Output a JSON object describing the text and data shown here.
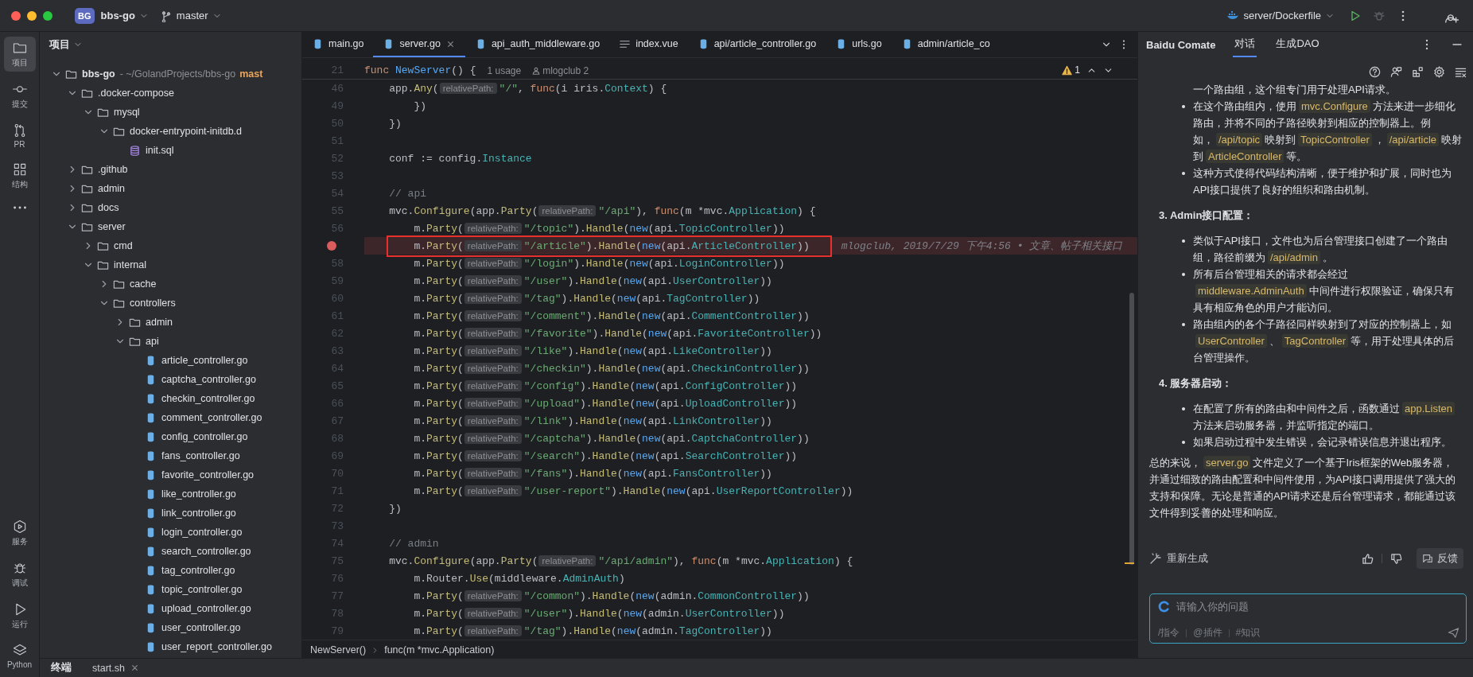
{
  "titlebar": {
    "project_badge": "BG",
    "project": "bbs-go",
    "branch": "master",
    "run_config": "server/Dockerfile"
  },
  "rail": {
    "top": [
      {
        "label": "项目",
        "selected": true
      },
      {
        "label": "提交",
        "selected": false
      },
      {
        "label": "PR",
        "selected": false
      },
      {
        "label": "结构",
        "selected": false
      }
    ],
    "bottom": [
      {
        "label": "服务",
        "selected": false
      },
      {
        "label": "调试",
        "selected": false
      },
      {
        "label": "运行",
        "selected": false
      },
      {
        "label": "Python",
        "selected": false
      }
    ]
  },
  "project": {
    "title": "项目",
    "root": {
      "name": "bbs-go",
      "path": "- ~/GolandProjects/bbs-go",
      "branch": "mast",
      "kind": "folder",
      "expanded": true,
      "children": [
        {
          "name": ".docker-compose",
          "kind": "folder",
          "expanded": true,
          "children": [
            {
              "name": "mysql",
              "kind": "folder",
              "expanded": true,
              "children": [
                {
                  "name": "docker-entrypoint-initdb.d",
                  "kind": "folder",
                  "expanded": true,
                  "children": [
                    {
                      "name": "init.sql",
                      "kind": "sql"
                    }
                  ]
                }
              ]
            }
          ]
        },
        {
          "name": ".github",
          "kind": "folder",
          "expanded": false
        },
        {
          "name": "admin",
          "kind": "folder",
          "expanded": false
        },
        {
          "name": "docs",
          "kind": "folder",
          "expanded": false
        },
        {
          "name": "server",
          "kind": "folder",
          "expanded": true,
          "children": [
            {
              "name": "cmd",
              "kind": "folder",
              "expanded": false
            },
            {
              "name": "internal",
              "kind": "folder",
              "expanded": true,
              "children": [
                {
                  "name": "cache",
                  "kind": "folder",
                  "expanded": false
                },
                {
                  "name": "controllers",
                  "kind": "folder",
                  "expanded": true,
                  "children": [
                    {
                      "name": "admin",
                      "kind": "folder",
                      "expanded": false
                    },
                    {
                      "name": "api",
                      "kind": "folder",
                      "expanded": true,
                      "children": [
                        {
                          "name": "article_controller.go",
                          "kind": "go"
                        },
                        {
                          "name": "captcha_controller.go",
                          "kind": "go"
                        },
                        {
                          "name": "checkin_controller.go",
                          "kind": "go"
                        },
                        {
                          "name": "comment_controller.go",
                          "kind": "go"
                        },
                        {
                          "name": "config_controller.go",
                          "kind": "go"
                        },
                        {
                          "name": "fans_controller.go",
                          "kind": "go"
                        },
                        {
                          "name": "favorite_controller.go",
                          "kind": "go"
                        },
                        {
                          "name": "like_controller.go",
                          "kind": "go"
                        },
                        {
                          "name": "link_controller.go",
                          "kind": "go"
                        },
                        {
                          "name": "login_controller.go",
                          "kind": "go"
                        },
                        {
                          "name": "search_controller.go",
                          "kind": "go"
                        },
                        {
                          "name": "tag_controller.go",
                          "kind": "go"
                        },
                        {
                          "name": "topic_controller.go",
                          "kind": "go"
                        },
                        {
                          "name": "upload_controller.go",
                          "kind": "go"
                        },
                        {
                          "name": "user_controller.go",
                          "kind": "go"
                        },
                        {
                          "name": "user_report_controller.go",
                          "kind": "go"
                        }
                      ]
                    }
                  ]
                }
              ]
            }
          ]
        }
      ]
    }
  },
  "editor": {
    "tabs": [
      {
        "label": "main.go",
        "kind": "go",
        "selected": false
      },
      {
        "label": "server.go",
        "kind": "go",
        "selected": true
      },
      {
        "label": "api_auth_middleware.go",
        "kind": "go",
        "selected": false
      },
      {
        "label": "index.vue",
        "kind": "vue",
        "selected": false
      },
      {
        "label": "api/article_controller.go",
        "kind": "go",
        "selected": false
      },
      {
        "label": "urls.go",
        "kind": "go",
        "selected": false
      },
      {
        "label": "admin/article_co",
        "kind": "go",
        "selected": false
      }
    ],
    "sticky_line": {
      "number": "21",
      "tokens": [
        {
          "kind": "keyword",
          "text": "func "
        },
        {
          "kind": "decl",
          "text": "NewServer"
        },
        {
          "kind": "plain",
          "text": "() {"
        }
      ],
      "hints": [
        {
          "kind": "usage",
          "text": "1 usage"
        },
        {
          "kind": "author",
          "text": "mlogclub 2"
        }
      ]
    },
    "warnings": "1",
    "lines": [
      {
        "number": "46",
        "breakpoint": false,
        "framed": false,
        "tokens": [
          {
            "kind": "plain",
            "text": "    app."
          },
          {
            "kind": "call",
            "text": "Any"
          },
          {
            "kind": "plain",
            "text": "("
          },
          {
            "kind": "hint",
            "text": "relativePath:"
          },
          {
            "kind": "string",
            "text": "\"/\""
          },
          {
            "kind": "plain",
            "text": ", "
          },
          {
            "kind": "keyword",
            "text": "func"
          },
          {
            "kind": "plain",
            "text": "(i iris."
          },
          {
            "kind": "type",
            "text": "Context"
          },
          {
            "kind": "plain",
            "text": ") {"
          }
        ]
      },
      {
        "number": "49",
        "breakpoint": false,
        "framed": false,
        "tokens": [
          {
            "kind": "plain",
            "text": "        })"
          }
        ]
      },
      {
        "number": "50",
        "breakpoint": false,
        "framed": false,
        "tokens": [
          {
            "kind": "plain",
            "text": "    })"
          }
        ]
      },
      {
        "number": "51",
        "breakpoint": false,
        "framed": false
      },
      {
        "number": "52",
        "breakpoint": false,
        "framed": false,
        "tokens": [
          {
            "kind": "plain",
            "text": "    conf := config."
          },
          {
            "kind": "type",
            "text": "Instance"
          }
        ]
      },
      {
        "number": "53",
        "breakpoint": false,
        "framed": false
      },
      {
        "number": "54",
        "breakpoint": false,
        "framed": false,
        "tokens": [
          {
            "kind": "comment",
            "text": "    // api"
          }
        ]
      },
      {
        "number": "55",
        "breakpoint": false,
        "framed": false,
        "tokens": [
          {
            "kind": "plain",
            "text": "    mvc."
          },
          {
            "kind": "call",
            "text": "Configure"
          },
          {
            "kind": "plain",
            "text": "(app."
          },
          {
            "kind": "call",
            "text": "Party"
          },
          {
            "kind": "plain",
            "text": "("
          },
          {
            "kind": "hint",
            "text": "relativePath:"
          },
          {
            "kind": "string",
            "text": "\"/api\""
          },
          {
            "kind": "plain",
            "text": "), "
          },
          {
            "kind": "keyword",
            "text": "func"
          },
          {
            "kind": "plain",
            "text": "(m *mvc."
          },
          {
            "kind": "type",
            "text": "Application"
          },
          {
            "kind": "plain",
            "text": ") {"
          }
        ]
      },
      {
        "number": "56",
        "breakpoint": false,
        "framed": false,
        "tokens": [
          {
            "kind": "plain",
            "text": "        m."
          },
          {
            "kind": "call",
            "text": "Party"
          },
          {
            "kind": "plain",
            "text": "("
          },
          {
            "kind": "hint",
            "text": "relativePath:"
          },
          {
            "kind": "string",
            "text": "\"/topic\""
          },
          {
            "kind": "plain",
            "text": ")."
          },
          {
            "kind": "call",
            "text": "Handle"
          },
          {
            "kind": "plain",
            "text": "("
          },
          {
            "kind": "builtin",
            "text": "new"
          },
          {
            "kind": "plain",
            "text": "(api."
          },
          {
            "kind": "type",
            "text": "TopicController"
          },
          {
            "kind": "plain",
            "text": "))"
          }
        ]
      },
      {
        "breakpoint": true,
        "framed": true,
        "blame": "mlogclub, 2019/7/29 下午4:56 • 文章、帖子相关接口",
        "tokens": [
          {
            "kind": "plain",
            "text": "        m."
          },
          {
            "kind": "call",
            "text": "Party"
          },
          {
            "kind": "plain",
            "text": "("
          },
          {
            "kind": "hint",
            "text": "relativePath:"
          },
          {
            "kind": "string",
            "text": "\"/article\""
          },
          {
            "kind": "plain",
            "text": ")."
          },
          {
            "kind": "call",
            "text": "Handle"
          },
          {
            "kind": "plain",
            "text": "("
          },
          {
            "kind": "builtin",
            "text": "new"
          },
          {
            "kind": "plain",
            "text": "(api."
          },
          {
            "kind": "type",
            "text": "ArticleController"
          },
          {
            "kind": "plain",
            "text": "))"
          }
        ]
      },
      {
        "number": "58",
        "breakpoint": false,
        "framed": false,
        "tokens": [
          {
            "kind": "plain",
            "text": "        m."
          },
          {
            "kind": "call",
            "text": "Party"
          },
          {
            "kind": "plain",
            "text": "("
          },
          {
            "kind": "hint",
            "text": "relativePath:"
          },
          {
            "kind": "string",
            "text": "\"/login\""
          },
          {
            "kind": "plain",
            "text": ")."
          },
          {
            "kind": "call",
            "text": "Handle"
          },
          {
            "kind": "plain",
            "text": "("
          },
          {
            "kind": "builtin",
            "text": "new"
          },
          {
            "kind": "plain",
            "text": "(api."
          },
          {
            "kind": "type",
            "text": "LoginController"
          },
          {
            "kind": "plain",
            "text": "))"
          }
        ]
      },
      {
        "number": "59",
        "breakpoint": false,
        "framed": false,
        "tokens": [
          {
            "kind": "plain",
            "text": "        m."
          },
          {
            "kind": "call",
            "text": "Party"
          },
          {
            "kind": "plain",
            "text": "("
          },
          {
            "kind": "hint",
            "text": "relativePath:"
          },
          {
            "kind": "string",
            "text": "\"/user\""
          },
          {
            "kind": "plain",
            "text": ")."
          },
          {
            "kind": "call",
            "text": "Handle"
          },
          {
            "kind": "plain",
            "text": "("
          },
          {
            "kind": "builtin",
            "text": "new"
          },
          {
            "kind": "plain",
            "text": "(api."
          },
          {
            "kind": "type",
            "text": "UserController"
          },
          {
            "kind": "plain",
            "text": "))"
          }
        ]
      },
      {
        "number": "60",
        "breakpoint": false,
        "framed": false,
        "tokens": [
          {
            "kind": "plain",
            "text": "        m."
          },
          {
            "kind": "call",
            "text": "Party"
          },
          {
            "kind": "plain",
            "text": "("
          },
          {
            "kind": "hint",
            "text": "relativePath:"
          },
          {
            "kind": "string",
            "text": "\"/tag\""
          },
          {
            "kind": "plain",
            "text": ")."
          },
          {
            "kind": "call",
            "text": "Handle"
          },
          {
            "kind": "plain",
            "text": "("
          },
          {
            "kind": "builtin",
            "text": "new"
          },
          {
            "kind": "plain",
            "text": "(api."
          },
          {
            "kind": "type",
            "text": "TagController"
          },
          {
            "kind": "plain",
            "text": "))"
          }
        ]
      },
      {
        "number": "61",
        "breakpoint": false,
        "framed": false,
        "tokens": [
          {
            "kind": "plain",
            "text": "        m."
          },
          {
            "kind": "call",
            "text": "Party"
          },
          {
            "kind": "plain",
            "text": "("
          },
          {
            "kind": "hint",
            "text": "relativePath:"
          },
          {
            "kind": "string",
            "text": "\"/comment\""
          },
          {
            "kind": "plain",
            "text": ")."
          },
          {
            "kind": "call",
            "text": "Handle"
          },
          {
            "kind": "plain",
            "text": "("
          },
          {
            "kind": "builtin",
            "text": "new"
          },
          {
            "kind": "plain",
            "text": "(api."
          },
          {
            "kind": "type",
            "text": "CommentController"
          },
          {
            "kind": "plain",
            "text": "))"
          }
        ]
      },
      {
        "number": "62",
        "breakpoint": false,
        "framed": false,
        "tokens": [
          {
            "kind": "plain",
            "text": "        m."
          },
          {
            "kind": "call",
            "text": "Party"
          },
          {
            "kind": "plain",
            "text": "("
          },
          {
            "kind": "hint",
            "text": "relativePath:"
          },
          {
            "kind": "string",
            "text": "\"/favorite\""
          },
          {
            "kind": "plain",
            "text": ")."
          },
          {
            "kind": "call",
            "text": "Handle"
          },
          {
            "kind": "plain",
            "text": "("
          },
          {
            "kind": "builtin",
            "text": "new"
          },
          {
            "kind": "plain",
            "text": "(api."
          },
          {
            "kind": "type",
            "text": "FavoriteController"
          },
          {
            "kind": "plain",
            "text": "))"
          }
        ]
      },
      {
        "number": "63",
        "breakpoint": false,
        "framed": false,
        "tokens": [
          {
            "kind": "plain",
            "text": "        m."
          },
          {
            "kind": "call",
            "text": "Party"
          },
          {
            "kind": "plain",
            "text": "("
          },
          {
            "kind": "hint",
            "text": "relativePath:"
          },
          {
            "kind": "string",
            "text": "\"/like\""
          },
          {
            "kind": "plain",
            "text": ")."
          },
          {
            "kind": "call",
            "text": "Handle"
          },
          {
            "kind": "plain",
            "text": "("
          },
          {
            "kind": "builtin",
            "text": "new"
          },
          {
            "kind": "plain",
            "text": "(api."
          },
          {
            "kind": "type",
            "text": "LikeController"
          },
          {
            "kind": "plain",
            "text": "))"
          }
        ]
      },
      {
        "number": "64",
        "breakpoint": false,
        "framed": false,
        "tokens": [
          {
            "kind": "plain",
            "text": "        m."
          },
          {
            "kind": "call",
            "text": "Party"
          },
          {
            "kind": "plain",
            "text": "("
          },
          {
            "kind": "hint",
            "text": "relativePath:"
          },
          {
            "kind": "string",
            "text": "\"/checkin\""
          },
          {
            "kind": "plain",
            "text": ")."
          },
          {
            "kind": "call",
            "text": "Handle"
          },
          {
            "kind": "plain",
            "text": "("
          },
          {
            "kind": "builtin",
            "text": "new"
          },
          {
            "kind": "plain",
            "text": "(api."
          },
          {
            "kind": "type",
            "text": "CheckinController"
          },
          {
            "kind": "plain",
            "text": "))"
          }
        ]
      },
      {
        "number": "65",
        "breakpoint": false,
        "framed": false,
        "tokens": [
          {
            "kind": "plain",
            "text": "        m."
          },
          {
            "kind": "call",
            "text": "Party"
          },
          {
            "kind": "plain",
            "text": "("
          },
          {
            "kind": "hint",
            "text": "relativePath:"
          },
          {
            "kind": "string",
            "text": "\"/config\""
          },
          {
            "kind": "plain",
            "text": ")."
          },
          {
            "kind": "call",
            "text": "Handle"
          },
          {
            "kind": "plain",
            "text": "("
          },
          {
            "kind": "builtin",
            "text": "new"
          },
          {
            "kind": "plain",
            "text": "(api."
          },
          {
            "kind": "type",
            "text": "ConfigController"
          },
          {
            "kind": "plain",
            "text": "))"
          }
        ]
      },
      {
        "number": "66",
        "breakpoint": false,
        "framed": false,
        "tokens": [
          {
            "kind": "plain",
            "text": "        m."
          },
          {
            "kind": "call",
            "text": "Party"
          },
          {
            "kind": "plain",
            "text": "("
          },
          {
            "kind": "hint",
            "text": "relativePath:"
          },
          {
            "kind": "string",
            "text": "\"/upload\""
          },
          {
            "kind": "plain",
            "text": ")."
          },
          {
            "kind": "call",
            "text": "Handle"
          },
          {
            "kind": "plain",
            "text": "("
          },
          {
            "kind": "builtin",
            "text": "new"
          },
          {
            "kind": "plain",
            "text": "(api."
          },
          {
            "kind": "type",
            "text": "UploadController"
          },
          {
            "kind": "plain",
            "text": "))"
          }
        ]
      },
      {
        "number": "67",
        "breakpoint": false,
        "framed": false,
        "tokens": [
          {
            "kind": "plain",
            "text": "        m."
          },
          {
            "kind": "call",
            "text": "Party"
          },
          {
            "kind": "plain",
            "text": "("
          },
          {
            "kind": "hint",
            "text": "relativePath:"
          },
          {
            "kind": "string",
            "text": "\"/link\""
          },
          {
            "kind": "plain",
            "text": ")."
          },
          {
            "kind": "call",
            "text": "Handle"
          },
          {
            "kind": "plain",
            "text": "("
          },
          {
            "kind": "builtin",
            "text": "new"
          },
          {
            "kind": "plain",
            "text": "(api."
          },
          {
            "kind": "type",
            "text": "LinkController"
          },
          {
            "kind": "plain",
            "text": "))"
          }
        ]
      },
      {
        "number": "68",
        "breakpoint": false,
        "framed": false,
        "tokens": [
          {
            "kind": "plain",
            "text": "        m."
          },
          {
            "kind": "call",
            "text": "Party"
          },
          {
            "kind": "plain",
            "text": "("
          },
          {
            "kind": "hint",
            "text": "relativePath:"
          },
          {
            "kind": "string",
            "text": "\"/captcha\""
          },
          {
            "kind": "plain",
            "text": ")."
          },
          {
            "kind": "call",
            "text": "Handle"
          },
          {
            "kind": "plain",
            "text": "("
          },
          {
            "kind": "builtin",
            "text": "new"
          },
          {
            "kind": "plain",
            "text": "(api."
          },
          {
            "kind": "type",
            "text": "CaptchaController"
          },
          {
            "kind": "plain",
            "text": "))"
          }
        ]
      },
      {
        "number": "69",
        "breakpoint": false,
        "framed": false,
        "tokens": [
          {
            "kind": "plain",
            "text": "        m."
          },
          {
            "kind": "call",
            "text": "Party"
          },
          {
            "kind": "plain",
            "text": "("
          },
          {
            "kind": "hint",
            "text": "relativePath:"
          },
          {
            "kind": "string",
            "text": "\"/search\""
          },
          {
            "kind": "plain",
            "text": ")."
          },
          {
            "kind": "call",
            "text": "Handle"
          },
          {
            "kind": "plain",
            "text": "("
          },
          {
            "kind": "builtin",
            "text": "new"
          },
          {
            "kind": "plain",
            "text": "(api."
          },
          {
            "kind": "type",
            "text": "SearchController"
          },
          {
            "kind": "plain",
            "text": "))"
          }
        ]
      },
      {
        "number": "70",
        "breakpoint": false,
        "framed": false,
        "tokens": [
          {
            "kind": "plain",
            "text": "        m."
          },
          {
            "kind": "call",
            "text": "Party"
          },
          {
            "kind": "plain",
            "text": "("
          },
          {
            "kind": "hint",
            "text": "relativePath:"
          },
          {
            "kind": "string",
            "text": "\"/fans\""
          },
          {
            "kind": "plain",
            "text": ")."
          },
          {
            "kind": "call",
            "text": "Handle"
          },
          {
            "kind": "plain",
            "text": "("
          },
          {
            "kind": "builtin",
            "text": "new"
          },
          {
            "kind": "plain",
            "text": "(api."
          },
          {
            "kind": "type",
            "text": "FansController"
          },
          {
            "kind": "plain",
            "text": "))"
          }
        ]
      },
      {
        "number": "71",
        "breakpoint": false,
        "framed": false,
        "tokens": [
          {
            "kind": "plain",
            "text": "        m."
          },
          {
            "kind": "call",
            "text": "Party"
          },
          {
            "kind": "plain",
            "text": "("
          },
          {
            "kind": "hint",
            "text": "relativePath:"
          },
          {
            "kind": "string",
            "text": "\"/user-report\""
          },
          {
            "kind": "plain",
            "text": ")."
          },
          {
            "kind": "call",
            "text": "Handle"
          },
          {
            "kind": "plain",
            "text": "("
          },
          {
            "kind": "builtin",
            "text": "new"
          },
          {
            "kind": "plain",
            "text": "(api."
          },
          {
            "kind": "type",
            "text": "UserReportController"
          },
          {
            "kind": "plain",
            "text": "))"
          }
        ]
      },
      {
        "number": "72",
        "breakpoint": false,
        "framed": false,
        "tokens": [
          {
            "kind": "plain",
            "text": "    })"
          }
        ]
      },
      {
        "number": "73",
        "breakpoint": false,
        "framed": false
      },
      {
        "number": "74",
        "breakpoint": false,
        "framed": false,
        "tokens": [
          {
            "kind": "comment",
            "text": "    // admin"
          }
        ]
      },
      {
        "number": "75",
        "breakpoint": false,
        "framed": false,
        "tokens": [
          {
            "kind": "plain",
            "text": "    mvc."
          },
          {
            "kind": "call",
            "text": "Configure"
          },
          {
            "kind": "plain",
            "text": "(app."
          },
          {
            "kind": "call",
            "text": "Party"
          },
          {
            "kind": "plain",
            "text": "("
          },
          {
            "kind": "hint",
            "text": "relativePath:"
          },
          {
            "kind": "string",
            "text": "\"/api/admin\""
          },
          {
            "kind": "plain",
            "text": "), "
          },
          {
            "kind": "keyword",
            "text": "func"
          },
          {
            "kind": "plain",
            "text": "(m *mvc."
          },
          {
            "kind": "type",
            "text": "Application"
          },
          {
            "kind": "plain",
            "text": ") {"
          }
        ]
      },
      {
        "number": "76",
        "breakpoint": false,
        "framed": false,
        "tokens": [
          {
            "kind": "plain",
            "text": "        m.Router."
          },
          {
            "kind": "call",
            "text": "Use"
          },
          {
            "kind": "plain",
            "text": "(middleware."
          },
          {
            "kind": "type",
            "text": "AdminAuth"
          },
          {
            "kind": "plain",
            "text": ")"
          }
        ]
      },
      {
        "number": "77",
        "breakpoint": false,
        "framed": false,
        "tokens": [
          {
            "kind": "plain",
            "text": "        m."
          },
          {
            "kind": "call",
            "text": "Party"
          },
          {
            "kind": "plain",
            "text": "("
          },
          {
            "kind": "hint",
            "text": "relativePath:"
          },
          {
            "kind": "string",
            "text": "\"/common\""
          },
          {
            "kind": "plain",
            "text": ")."
          },
          {
            "kind": "call",
            "text": "Handle"
          },
          {
            "kind": "plain",
            "text": "("
          },
          {
            "kind": "builtin",
            "text": "new"
          },
          {
            "kind": "plain",
            "text": "(admin."
          },
          {
            "kind": "type",
            "text": "CommonController"
          },
          {
            "kind": "plain",
            "text": "))"
          }
        ]
      },
      {
        "number": "78",
        "breakpoint": false,
        "framed": false,
        "tokens": [
          {
            "kind": "plain",
            "text": "        m."
          },
          {
            "kind": "call",
            "text": "Party"
          },
          {
            "kind": "plain",
            "text": "("
          },
          {
            "kind": "hint",
            "text": "relativePath:"
          },
          {
            "kind": "string",
            "text": "\"/user\""
          },
          {
            "kind": "plain",
            "text": ")."
          },
          {
            "kind": "call",
            "text": "Handle"
          },
          {
            "kind": "plain",
            "text": "("
          },
          {
            "kind": "builtin",
            "text": "new"
          },
          {
            "kind": "plain",
            "text": "(admin."
          },
          {
            "kind": "type",
            "text": "UserController"
          },
          {
            "kind": "plain",
            "text": "))"
          }
        ]
      },
      {
        "number": "79",
        "breakpoint": false,
        "framed": false,
        "tokens": [
          {
            "kind": "plain",
            "text": "        m."
          },
          {
            "kind": "call",
            "text": "Party"
          },
          {
            "kind": "plain",
            "text": "("
          },
          {
            "kind": "hint",
            "text": "relativePath:"
          },
          {
            "kind": "string",
            "text": "\"/tag\""
          },
          {
            "kind": "plain",
            "text": ")."
          },
          {
            "kind": "call",
            "text": "Handle"
          },
          {
            "kind": "plain",
            "text": "("
          },
          {
            "kind": "builtin",
            "text": "new"
          },
          {
            "kind": "plain",
            "text": "(admin."
          },
          {
            "kind": "type",
            "text": "TagController"
          },
          {
            "kind": "plain",
            "text": "))"
          }
        ]
      }
    ],
    "breadcrumbs": [
      "NewServer()",
      "func(m *mvc.Application)"
    ]
  },
  "bottom_tabs": [
    {
      "label": "终端",
      "selected": true
    },
    {
      "label": "start.sh",
      "selected": false
    }
  ],
  "assistant": {
    "title": "Baidu Comate",
    "tabs": [
      {
        "label": "对话",
        "selected": true
      },
      {
        "label": "生成DAO",
        "selected": false
      }
    ],
    "blocks": [
      {
        "kind": "continuation",
        "segments": [
          {
            "text": "一个路由组，这个组专门用于处理API请求。",
            "code": false
          }
        ]
      },
      {
        "kind": "bullet",
        "segments": [
          {
            "text": "在这个路由组内，使用",
            "code": false
          },
          {
            "text": "mvc.Configure",
            "code": true
          },
          {
            "text": "方法来进一步细化路由，并将不同的子路径映射到相应的控制器上。例如，",
            "code": false
          },
          {
            "text": "/api/topic",
            "code": true
          },
          {
            "text": "映射到",
            "code": false
          },
          {
            "text": "TopicController",
            "code": true
          },
          {
            "text": "，",
            "code": false
          },
          {
            "text": "/api/article",
            "code": true
          },
          {
            "text": "映射到",
            "code": false
          },
          {
            "text": "ArticleController",
            "code": true
          },
          {
            "text": "等。",
            "code": false
          }
        ]
      },
      {
        "kind": "bullet",
        "segments": [
          {
            "text": "这种方式使得代码结构清晰，便于维护和扩展，同时也为API接口提供了良好的组织和路由机制。",
            "code": false
          }
        ]
      },
      {
        "kind": "heading",
        "segments": [
          {
            "text": "3. Admin接口配置：",
            "code": false
          }
        ]
      },
      {
        "kind": "bullet",
        "segments": [
          {
            "text": "类似于API接口，文件也为后台管理接口创建了一个路由组，路径前缀为",
            "code": false
          },
          {
            "text": "/api/admin",
            "code": true
          },
          {
            "text": "。",
            "code": false
          }
        ]
      },
      {
        "kind": "bullet",
        "segments": [
          {
            "text": "所有后台管理相关的请求都会经过",
            "code": false
          },
          {
            "text": "middleware.AdminAuth",
            "code": true
          },
          {
            "text": "中间件进行权限验证，确保只有具有相应角色的用户才能访问。",
            "code": false
          }
        ]
      },
      {
        "kind": "bullet",
        "segments": [
          {
            "text": "路由组内的各个子路径同样映射到了对应的控制器上，如",
            "code": false
          },
          {
            "text": "UserController",
            "code": true
          },
          {
            "text": "、",
            "code": false
          },
          {
            "text": "TagController",
            "code": true
          },
          {
            "text": "等，用于处理具体的后台管理操作。",
            "code": false
          }
        ]
      },
      {
        "kind": "heading",
        "segments": [
          {
            "text": "4. 服务器启动：",
            "code": false
          }
        ]
      },
      {
        "kind": "bullet",
        "segments": [
          {
            "text": "在配置了所有的路由和中间件之后，函数通过",
            "code": false
          },
          {
            "text": "app.Listen",
            "code": true
          },
          {
            "text": "方法来启动服务器，并监听指定的端口。",
            "code": false
          }
        ]
      },
      {
        "kind": "bullet",
        "segments": [
          {
            "text": "如果启动过程中发生错误，会记录错误信息并退出程序。",
            "code": false
          }
        ]
      },
      {
        "kind": "paragraph",
        "segments": [
          {
            "text": "总的来说，",
            "code": false
          },
          {
            "text": "server.go",
            "code": true
          },
          {
            "text": "文件定义了一个基于Iris框架的Web服务器，并通过细致的路由配置和中间件使用，为API接口调用提供了强大的支持和保障。无论是普通的API请求还是后台管理请求，都能通过该文件得到妥善的处理和响应。",
            "code": false
          }
        ]
      }
    ],
    "regenerate": "重新生成",
    "feedback": "反馈",
    "input": {
      "placeholder": "请输入你的问题",
      "shortcuts": [
        "/指令",
        "@插件",
        "#知识"
      ]
    }
  }
}
